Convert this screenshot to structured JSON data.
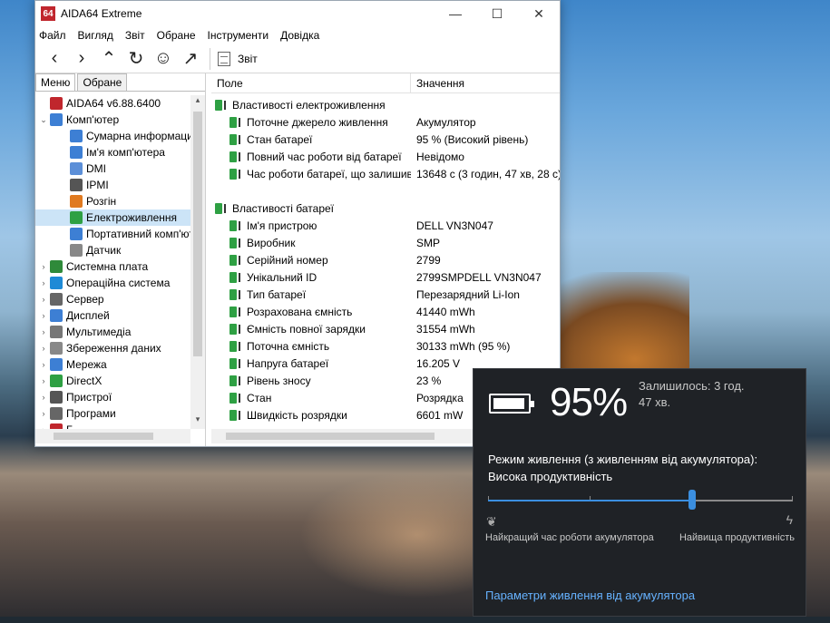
{
  "colors": {
    "accent": "#3b8fe0",
    "battery_green": "#2ea043",
    "app_red": "#c0262d"
  },
  "window": {
    "app_logo": "64",
    "title": "AIDA64 Extreme",
    "controls": {
      "minimize": "—",
      "maximize": "☐",
      "close": "✕"
    },
    "menu": [
      "Файл",
      "Вигляд",
      "Звіт",
      "Обране",
      "Інструменти",
      "Довідка"
    ],
    "toolbar": {
      "report_label": "Звіт"
    }
  },
  "left_panel": {
    "tabs": [
      "Меню",
      "Обране"
    ],
    "tree": [
      {
        "label": "AIDA64 v6.88.6400",
        "indent": 0,
        "icon": "aida-icon",
        "arrow": ""
      },
      {
        "label": "Комп'ютер",
        "indent": 1,
        "icon": "computer-icon",
        "arrow": "v"
      },
      {
        "label": "Сумарна информация",
        "indent": 2,
        "icon": "summary-icon",
        "arrow": ""
      },
      {
        "label": "Ім'я комп'ютера",
        "indent": 2,
        "icon": "computer-name-icon",
        "arrow": ""
      },
      {
        "label": "DMI",
        "indent": 2,
        "icon": "dmi-icon",
        "arrow": ""
      },
      {
        "label": "IPMI",
        "indent": 2,
        "icon": "ipmi-icon",
        "arrow": ""
      },
      {
        "label": "Розгін",
        "indent": 2,
        "icon": "overclock-icon",
        "arrow": ""
      },
      {
        "label": "Електроживлення",
        "indent": 2,
        "icon": "battery-icon",
        "arrow": "",
        "selected": true
      },
      {
        "label": "Портативний комп'ютер",
        "indent": 2,
        "icon": "laptop-icon",
        "arrow": ""
      },
      {
        "label": "Датчик",
        "indent": 2,
        "icon": "sensor-icon",
        "arrow": ""
      },
      {
        "label": "Системна плата",
        "indent": 1,
        "icon": "motherboard-icon",
        "arrow": ">"
      },
      {
        "label": "Операційна система",
        "indent": 1,
        "icon": "windows-icon",
        "arrow": ">"
      },
      {
        "label": "Сервер",
        "indent": 1,
        "icon": "server-icon",
        "arrow": ">"
      },
      {
        "label": "Дисплей",
        "indent": 1,
        "icon": "display-icon",
        "arrow": ">"
      },
      {
        "label": "Мультимедіа",
        "indent": 1,
        "icon": "multimedia-icon",
        "arrow": ">"
      },
      {
        "label": "Збереження даних",
        "indent": 1,
        "icon": "storage-icon",
        "arrow": ">"
      },
      {
        "label": "Мережа",
        "indent": 1,
        "icon": "network-icon",
        "arrow": ">"
      },
      {
        "label": "DirectX",
        "indent": 1,
        "icon": "directx-icon",
        "arrow": ">"
      },
      {
        "label": "Пристрої",
        "indent": 1,
        "icon": "devices-icon",
        "arrow": ">"
      },
      {
        "label": "Програми",
        "indent": 1,
        "icon": "programs-icon",
        "arrow": ">"
      },
      {
        "label": "Б...",
        "indent": 1,
        "icon": "security-icon",
        "arrow": ">"
      }
    ]
  },
  "table": {
    "headers": [
      "Поле",
      "Значення"
    ],
    "sections": [
      {
        "title": "Властивості електроживлення",
        "rows": [
          [
            "Поточне джерело живлення",
            "Акумулятор"
          ],
          [
            "Стан батареї",
            "95 % (Високий рівень)"
          ],
          [
            "Повний час роботи від батареї",
            "Невідомо"
          ],
          [
            "Час роботи батареї, що залишився",
            "13648 с (3 годин, 47 хв, 28 с)"
          ]
        ]
      },
      {
        "title": "Властивості батареї",
        "rows": [
          [
            "Ім'я пристрою",
            "DELL VN3N047"
          ],
          [
            "Виробник",
            "SMP"
          ],
          [
            "Серійний номер",
            "2799"
          ],
          [
            "Унікальний ID",
            "2799SMPDELL VN3N047"
          ],
          [
            "Тип батареї",
            "Перезарядний Li-Ion"
          ],
          [
            "Розрахована ємність",
            "41440 mWh"
          ],
          [
            "Ємність повної зарядки",
            "31554 mWh"
          ],
          [
            "Поточна ємність",
            "30133 mWh  (95 %)"
          ],
          [
            "Напруга батареї",
            "16.205 V"
          ],
          [
            "Рівень зносу",
            "23 %"
          ],
          [
            "Стан",
            "Розрядка"
          ],
          [
            "Швидкість розрядки",
            "6601 mW"
          ]
        ]
      }
    ]
  },
  "flyout": {
    "percent": "95%",
    "charge_fraction": 0.95,
    "remaining_line1": "Залишилось: 3 год.",
    "remaining_line2": "47 хв.",
    "mode_line1": "Режим живлення (з живленням від акумулятора):",
    "mode_line2": "Висока продуктивність",
    "slider_fraction": 0.67,
    "label_left": "Найкращий час роботи акумулятора",
    "label_right": "Найвища продуктивність",
    "link": "Параметри живлення від акумулятора"
  }
}
